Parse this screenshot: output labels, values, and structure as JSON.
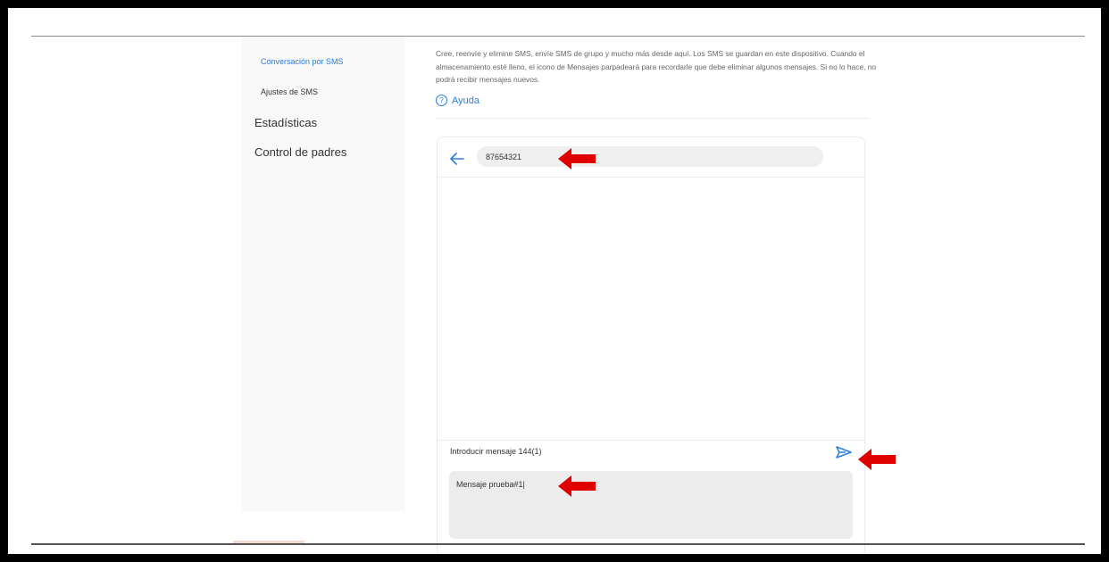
{
  "sidebar": {
    "sms_conversation": "Conversación por SMS",
    "sms_settings": "Ajustes de SMS",
    "statistics": "Estadísticas",
    "parental_control": "Control de padres"
  },
  "main": {
    "description": "Cree, reenvíe y elimine SMS, envíe SMS de grupo y mucho más desde aquí. Los SMS se guardan en este dispositivo. Cuando el almacenamiento esté lleno, el icono de Mensajes parpadeará para recordarle que debe eliminar algunos mensajes. Si no lo hace, no podrá recibir mensajes nuevos.",
    "help_icon": "?",
    "help_label": "Ayuda"
  },
  "conversation": {
    "recipient_value": "87654321",
    "counter_label": "Introducir mensaje 144(1)",
    "message_value": "Mensaje prueba#1|"
  },
  "icons": {
    "back": "arrow-left-icon",
    "send": "send-icon",
    "help": "help-circle-icon",
    "annotation": "red-arrow-left-icon"
  },
  "colors": {
    "accent": "#2a7de1",
    "annotation": "#e00000",
    "input_bg": "#efefef"
  }
}
